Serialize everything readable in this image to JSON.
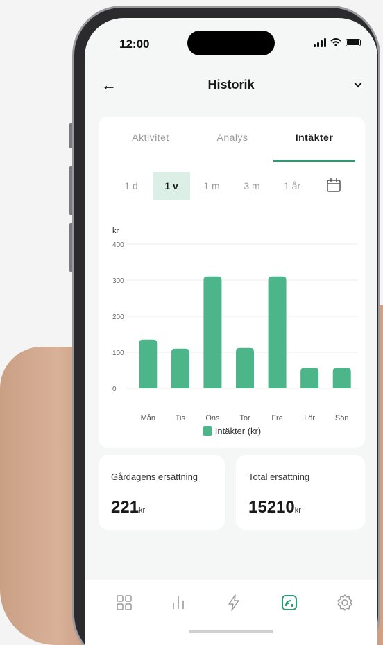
{
  "status_bar": {
    "time": "12:00"
  },
  "header": {
    "title": "Historik"
  },
  "tabs": [
    {
      "label": "Aktivitet"
    },
    {
      "label": "Analys"
    },
    {
      "label": "Intäkter"
    }
  ],
  "periods": [
    {
      "label": "1 d"
    },
    {
      "label": "1 v"
    },
    {
      "label": "1 m"
    },
    {
      "label": "3 m"
    },
    {
      "label": "1 år"
    }
  ],
  "chart_data": {
    "type": "bar",
    "ylabel": "kr",
    "categories": [
      "Mån",
      "Tis",
      "Ons",
      "Tor",
      "Fre",
      "Lör",
      "Sön"
    ],
    "series": [
      {
        "name": "Intäkter (kr)",
        "values": [
          135,
          110,
          310,
          112,
          310,
          57,
          57
        ]
      }
    ],
    "ylim": [
      0,
      400
    ],
    "yticks": [
      0,
      100,
      200,
      300,
      400
    ],
    "grid": true,
    "legend": "bottom-center",
    "color": "#4cb68a"
  },
  "stats": {
    "yesterday": {
      "label": "Gårdagens ersättning",
      "value": "221",
      "unit": "kr"
    },
    "total": {
      "label": "Total ersättning",
      "value": "15210",
      "unit": "kr"
    }
  },
  "colors": {
    "accent": "#2f9a72",
    "bar": "#4cb68a",
    "active_period_bg": "#dcefe6"
  },
  "nav": [
    "dashboard-icon",
    "stats-icon",
    "lightning-icon",
    "income-icon",
    "settings-icon"
  ]
}
